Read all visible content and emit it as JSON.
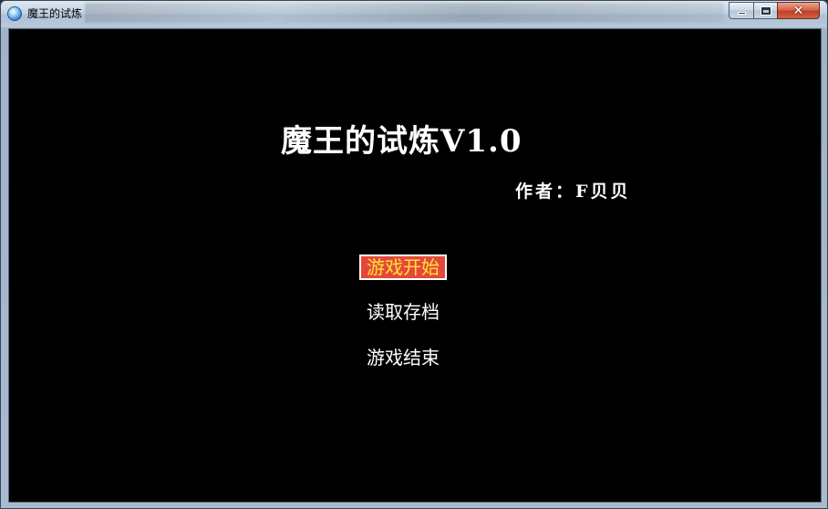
{
  "window": {
    "title": "魔王的试炼",
    "close_glyph": "✕"
  },
  "game": {
    "title": "魔王的试炼V1.0",
    "author": "作者：F贝贝",
    "menu": [
      {
        "label": "游戏开始",
        "selected": true
      },
      {
        "label": "读取存档",
        "selected": false
      },
      {
        "label": "游戏结束",
        "selected": false
      }
    ],
    "colors": {
      "background": "#000000",
      "selected_bg": "#e4483c",
      "selected_text": "#ffe335",
      "text": "#ffffff"
    }
  }
}
